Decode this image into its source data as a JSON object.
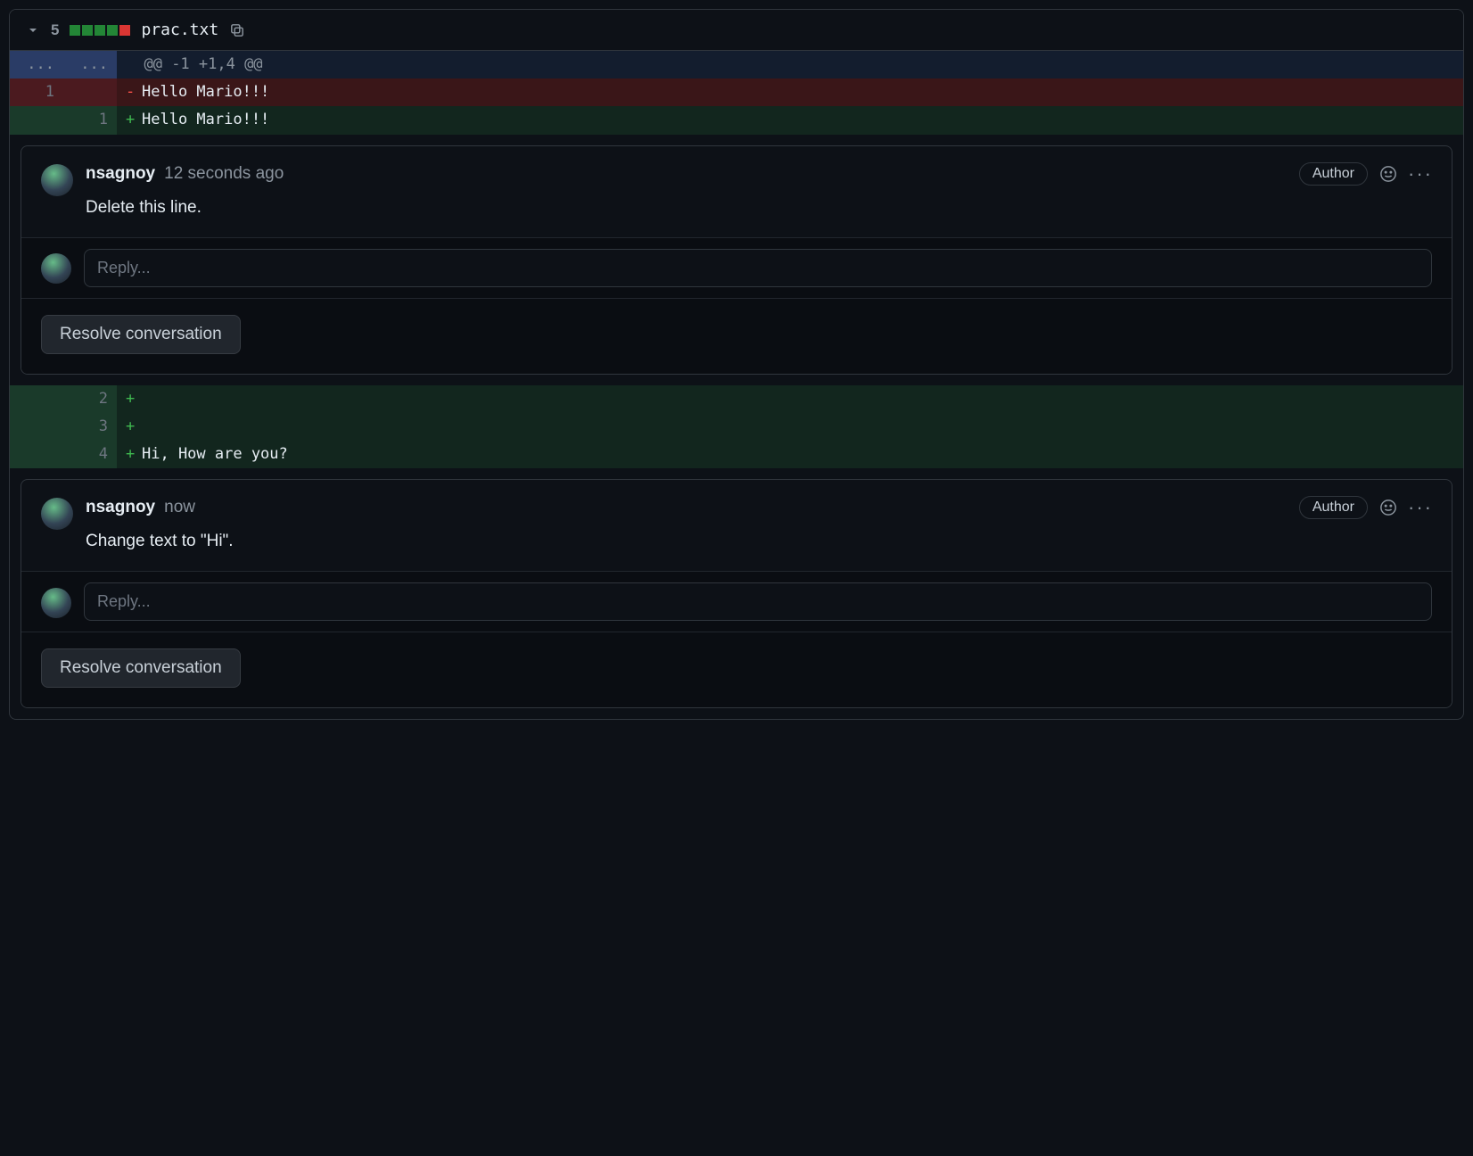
{
  "file": {
    "change_count": "5",
    "diffstat": {
      "adds": 4,
      "dels": 1
    },
    "name": "prac.txt",
    "hunk_header": "@@ -1 +1,4 @@",
    "lines_top": [
      {
        "type": "del",
        "old": "1",
        "new": "",
        "marker": "-",
        "text": "Hello Mario!!!"
      },
      {
        "type": "add",
        "old": "",
        "new": "1",
        "marker": "+",
        "text": "Hello Mario!!!"
      }
    ],
    "lines_bottom": [
      {
        "type": "add",
        "old": "",
        "new": "2",
        "marker": "+",
        "text": ""
      },
      {
        "type": "add",
        "old": "",
        "new": "3",
        "marker": "+",
        "text": ""
      },
      {
        "type": "add",
        "old": "",
        "new": "4",
        "marker": "+",
        "text": "Hi, How are you?"
      }
    ]
  },
  "threads": [
    {
      "author": "nsagnoy",
      "time": "12 seconds ago",
      "badge": "Author",
      "body": "Delete this line.",
      "reply_placeholder": "Reply...",
      "resolve_label": "Resolve conversation"
    },
    {
      "author": "nsagnoy",
      "time": "now",
      "badge": "Author",
      "body": "Change text to \"Hi\".",
      "reply_placeholder": "Reply...",
      "resolve_label": "Resolve conversation"
    }
  ],
  "hunk_dots": "..."
}
